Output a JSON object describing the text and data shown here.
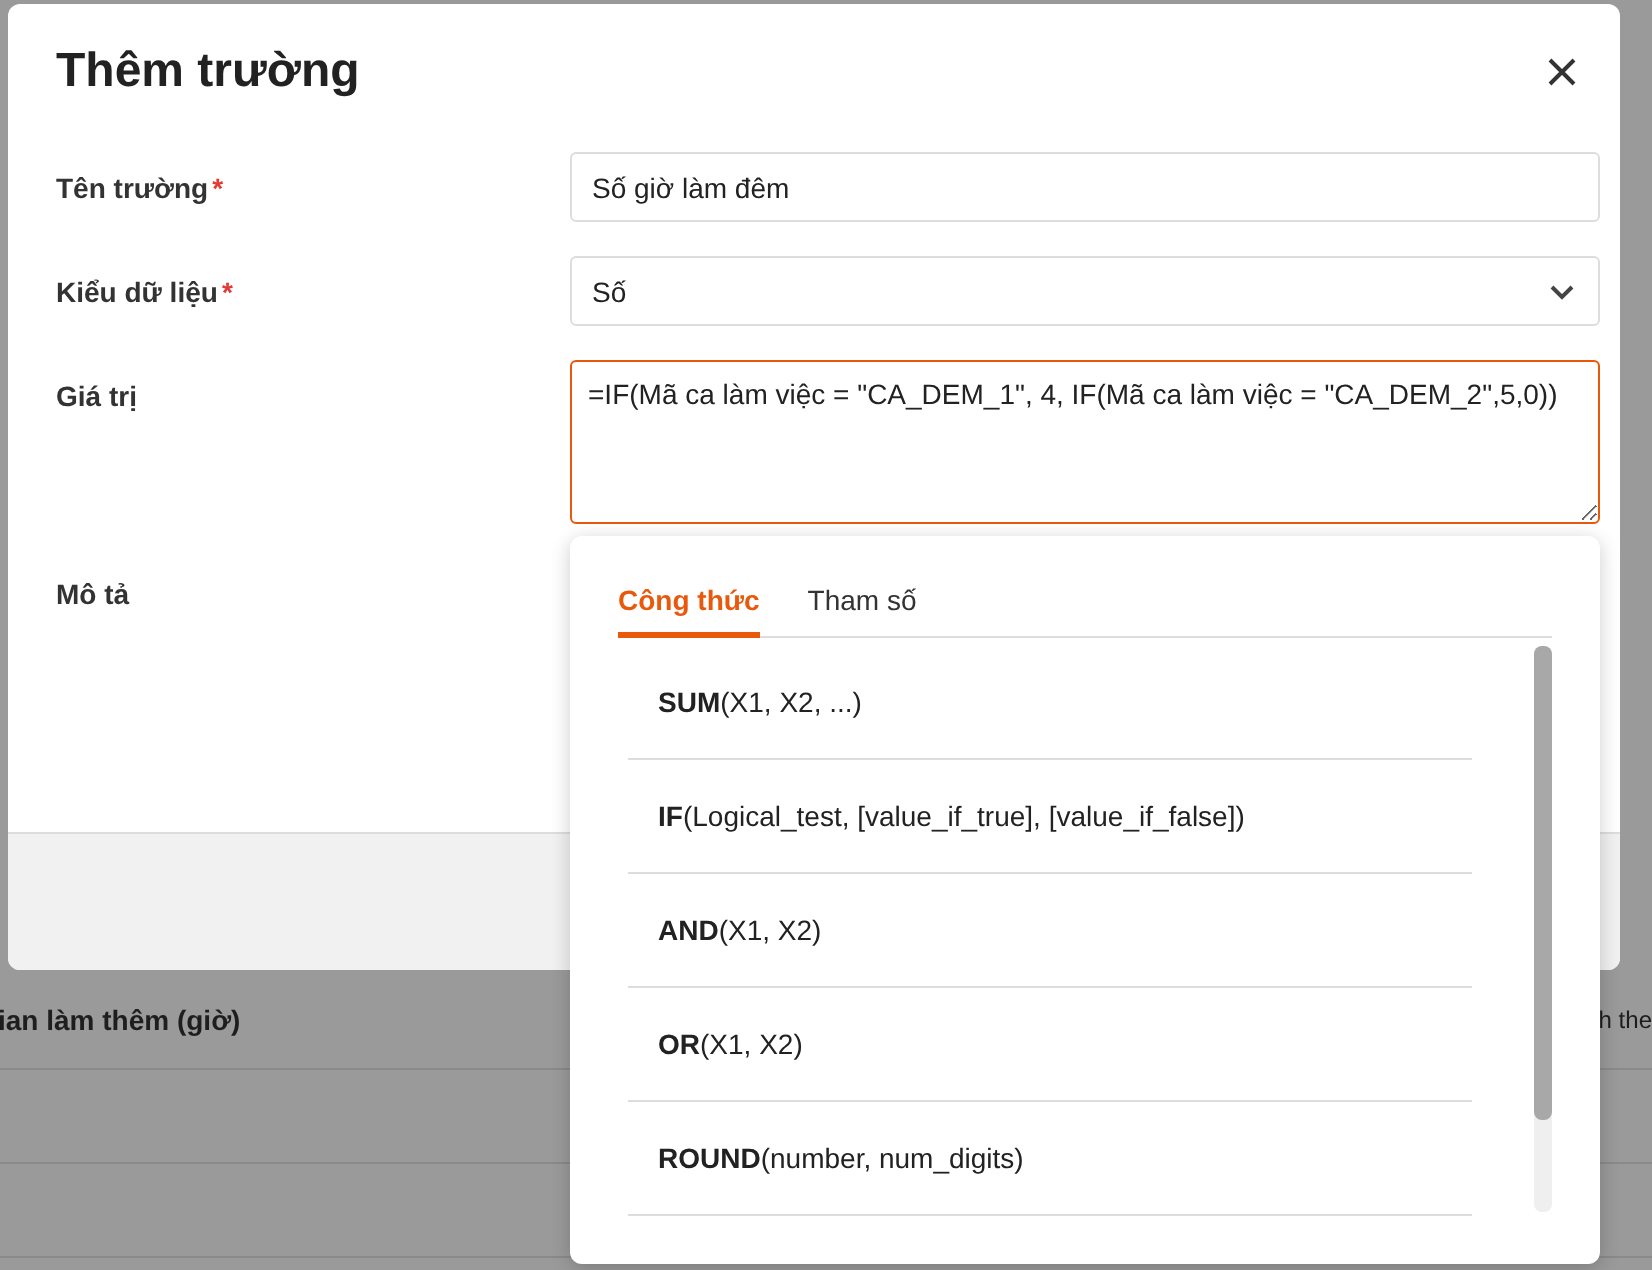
{
  "background": {
    "table_header": [
      "ian làm thêm (giờ)",
      "h the"
    ]
  },
  "dialog": {
    "title": "Thêm trường",
    "fields": [
      {
        "kind": "text",
        "label": "Tên trường",
        "required_mark": "*",
        "value": "Số giờ làm đêm"
      },
      {
        "kind": "select",
        "label": "Kiểu dữ liệu",
        "required_mark": "*",
        "value": "Số"
      },
      {
        "kind": "textarea",
        "label": "Giá trị",
        "focused": true,
        "value": "=IF(Mã ca làm việc = \"CA_DEM_1\", 4, IF(Mã ca làm việc = \"CA_DEM_2\",5,0))"
      },
      {
        "kind": "label",
        "label": "Mô tả"
      }
    ]
  },
  "formula_popup": {
    "tabs": [
      {
        "label": "Công thức",
        "selected": true
      },
      {
        "label": "Tham số",
        "selected": false
      }
    ],
    "items": [
      {
        "text": "**SUM**(X1, X2, ...)"
      },
      {
        "text": "**IF**(Logical_test, [value_if_true], [value_if_false])"
      },
      {
        "text": "**AND**(X1, X2)"
      },
      {
        "text": "**OR**(X1, X2)"
      },
      {
        "text": "**ROUND**(number, num_digits)"
      }
    ]
  }
}
